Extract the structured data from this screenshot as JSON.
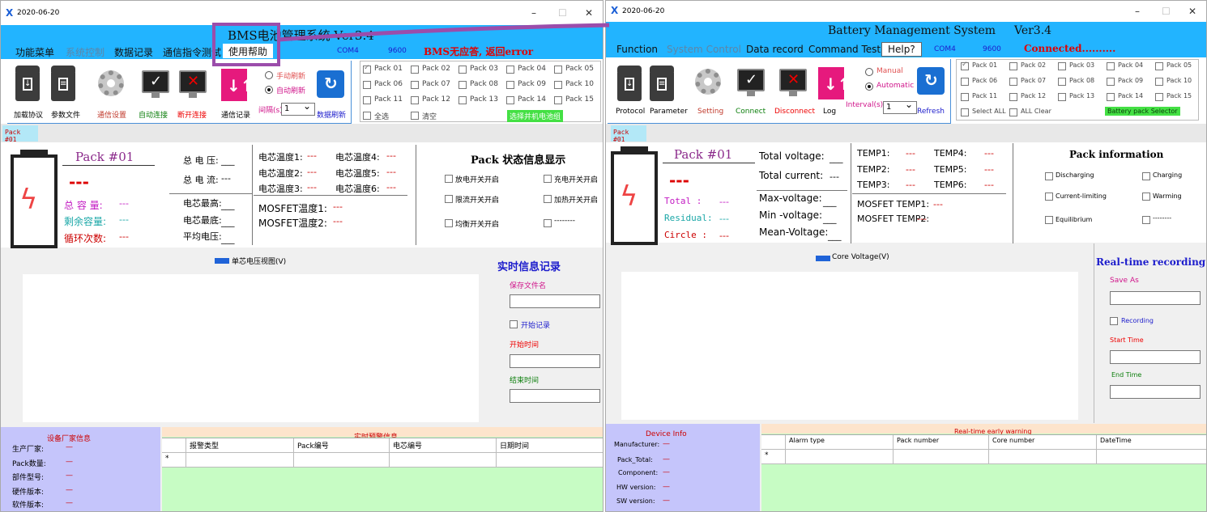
{
  "left": {
    "window": {
      "date": "2020-06-20",
      "app_icon": "X",
      "controls": [
        "–",
        "☐",
        "✕"
      ]
    },
    "banner": {
      "title": "BMS电池管理系统 Ver3.4"
    },
    "menu": {
      "function": "功能菜单",
      "system_control": "系统控制",
      "data_record": "数据记录",
      "command_test": "通信指令测试",
      "help": "使用帮助",
      "com_port": "COM4",
      "baud": "9600",
      "status": "BMS无应答, 返回error"
    },
    "toolbar": {
      "protocol": "加载协议",
      "parameter": "参数文件",
      "setting": "通信设置",
      "connect": "自动连接",
      "disconnect": "断开连接",
      "log": "通信记录",
      "manual": "手动刷新",
      "automatic": "自动刷新",
      "interval_label": "间隔(s)",
      "interval_value": "1",
      "refresh": "数据刷新"
    },
    "packs": {
      "items": [
        "Pack 01",
        "Pack 02",
        "Pack 03",
        "Pack 04",
        "Pack 05",
        "Pack 06",
        "Pack 07",
        "Pack 08",
        "Pack 09",
        "Pack 10",
        "Pack 11",
        "Pack 12",
        "Pack 13",
        "Pack 14",
        "Pack 15"
      ],
      "checked": [
        true,
        false,
        false,
        false,
        false,
        false,
        false,
        false,
        false,
        false,
        false,
        false,
        false,
        false,
        false
      ],
      "select_all": "全选",
      "clear_all": "清空",
      "selector": "选择并机电池组"
    },
    "tab": "Pack #01",
    "info": {
      "pack_title": "Pack #01",
      "dashes": "---",
      "total_label": "总 容 量:",
      "residual_label": "剩余容量:",
      "circle_label": "循环次数:",
      "total_value": "---",
      "residual_value": "---",
      "circle_value": "---"
    },
    "volt": {
      "total_voltage": "总 电 压:",
      "total_voltage_value": "___",
      "total_current": "总 电 流:",
      "total_current_value": "---",
      "max_voltage": "电芯最高:",
      "max_voltage_value": "___",
      "min_voltage": "电芯最底:",
      "min_voltage_value": "___",
      "mean_voltage": "平均电压:",
      "mean_voltage_value": "___"
    },
    "temps": {
      "t1": "电芯温度1:",
      "t2": "电芯温度2:",
      "t3": "电芯温度3:",
      "t4": "电芯温度4:",
      "t5": "电芯温度5:",
      "t6": "电芯温度6:",
      "v": "---",
      "mos1": "MOSFET温度1:",
      "mos2": "MOSFET温度2:"
    },
    "status": {
      "title": "Pack 状态信息显示",
      "discharging": "放电开关开启",
      "charging": "充电开关开启",
      "current_limiting": "限流开关开启",
      "warming": "加热开关开启",
      "equilibrium": "均衡开关开启",
      "blank": "--------"
    },
    "chart_legend": "单芯电压视图(V)",
    "rec": {
      "title": "实时信息记录",
      "save_as": "保存文件名",
      "recording": "开始记录",
      "start_time": "开始时间",
      "end_time": "结束时间"
    },
    "device": {
      "title": "设备厂家信息",
      "manufacturer": "生产厂家:",
      "pack_total": "Pack数量:",
      "component": "部件型号:",
      "hw": "硬件版本:",
      "sw": "软件版本:",
      "value": "—"
    },
    "alarm": {
      "title": "实时预警信息",
      "cols": [
        "报警类型",
        "Pack编号",
        "电芯编号",
        "日期时间"
      ],
      "marker": "*"
    }
  },
  "right": {
    "window": {
      "date": "2020-06-20",
      "app_icon": "X",
      "controls": [
        "–",
        "☐",
        "✕"
      ]
    },
    "banner": {
      "title1": "Battery Management System",
      "title2": "Ver3.4"
    },
    "menu": {
      "function": "Function",
      "system_control": "System Control",
      "data_record": "Data record",
      "command_test": "Command Test",
      "help": "Help?",
      "com_port": "COM4",
      "baud": "9600",
      "status": "Connected.........."
    },
    "toolbar": {
      "protocol": "Protocol",
      "parameter": "Parameter",
      "setting": "Setting",
      "connect": "Connect",
      "disconnect": "Disconnect",
      "log": "Log",
      "manual": "Manual",
      "automatic": "Automatic",
      "interval_label": "Interval(s)",
      "interval_value": "1",
      "refresh": "Refresh"
    },
    "packs": {
      "items": [
        "Pack 01",
        "Pack 02",
        "Pack 03",
        "Pack 04",
        "Pack 05",
        "Pack 06",
        "Pack 07",
        "Pack 08",
        "Pack 09",
        "Pack 10",
        "Pack 11",
        "Pack 12",
        "Pack 13",
        "Pack 14",
        "Pack 15"
      ],
      "checked": [
        true,
        false,
        false,
        false,
        false,
        false,
        false,
        false,
        false,
        false,
        false,
        false,
        false,
        false,
        false
      ],
      "select_all": "Select ALL",
      "clear_all": "ALL Clear",
      "selector": "Battery pack Selector"
    },
    "tab": "Pack #01",
    "info": {
      "pack_title": "Pack #01",
      "dashes": "---",
      "total_label": "Total :",
      "residual_label": "Residual:",
      "circle_label": "Circle :",
      "total_value": "---",
      "residual_value": "---",
      "circle_value": "---"
    },
    "volt": {
      "total_voltage": "Total voltage:",
      "total_voltage_value": "___",
      "total_current": "Total current:",
      "total_current_value": "---",
      "max_voltage": "Max-voltage:",
      "max_voltage_value": "___",
      "min_voltage": "Min -voltage:",
      "min_voltage_value": "___",
      "mean_voltage": "Mean-Voltage:",
      "mean_voltage_value": "___"
    },
    "temps": {
      "t1": "TEMP1:",
      "t2": "TEMP2:",
      "t3": "TEMP3:",
      "t4": "TEMP4:",
      "t5": "TEMP5:",
      "t6": "TEMP6:",
      "v": "---",
      "mos1": "MOSFET TEMP1:",
      "mos2": "MOSFET TEMP2:"
    },
    "status": {
      "title": "Pack information",
      "discharging": "Discharging",
      "charging": "Charging",
      "current_limiting": "Current-limiting",
      "warming": "Warming",
      "equilibrium": "Equilibrium",
      "blank": "--------"
    },
    "chart_legend": "Core Voltage(V)",
    "rec": {
      "title": "Real-time recording",
      "save_as": "Save As",
      "recording": "Recording",
      "start_time": "Start Time",
      "end_time": "End Time"
    },
    "device": {
      "title": "Device Info",
      "manufacturer": "Manufacturer:",
      "pack_total": "Pack_Total:",
      "component": "Component:",
      "hw": "HW version:",
      "sw": "SW version:",
      "value": "—"
    },
    "alarm": {
      "title": "Real-time early warning",
      "cols": [
        "Alarm type",
        "Pack number",
        "Core number",
        "DateTime"
      ],
      "marker": "*"
    }
  }
}
